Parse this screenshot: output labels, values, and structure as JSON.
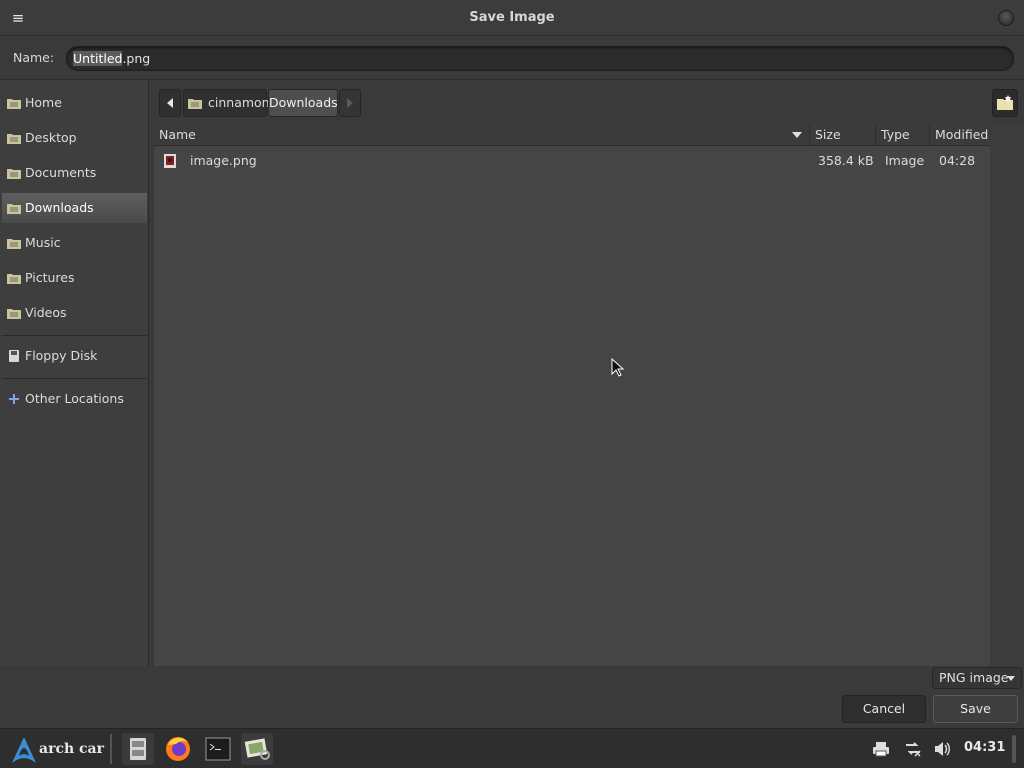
{
  "window": {
    "title": "Save Image",
    "menu_icon": "hamburger-menu-icon",
    "control_icon": "window-control-icon"
  },
  "name_row": {
    "label": "Name:",
    "value_selected": "Untitled",
    "value_rest": ".png"
  },
  "sidebar": {
    "places": [
      {
        "label": "Home",
        "icon": "folder-home-icon",
        "active": false
      },
      {
        "label": "Desktop",
        "icon": "folder-desktop-icon",
        "active": false
      },
      {
        "label": "Documents",
        "icon": "folder-documents-icon",
        "active": false
      },
      {
        "label": "Downloads",
        "icon": "folder-downloads-icon",
        "active": true
      },
      {
        "label": "Music",
        "icon": "folder-music-icon",
        "active": false
      },
      {
        "label": "Pictures",
        "icon": "folder-pictures-icon",
        "active": false
      },
      {
        "label": "Videos",
        "icon": "folder-videos-icon",
        "active": false
      }
    ],
    "devices": [
      {
        "label": "Floppy Disk",
        "icon": "floppy-disk-icon"
      }
    ],
    "other": {
      "label": "Other Locations",
      "icon": "plus-icon"
    }
  },
  "pathbar": {
    "back_icon": "chevron-left-icon",
    "crumbs": [
      "cinnamon",
      "Downloads"
    ],
    "forward_icon": "chevron-right-icon",
    "new_folder_icon": "new-folder-icon"
  },
  "columns": {
    "name": "Name",
    "size": "Size",
    "type": "Type",
    "modified": "Modified"
  },
  "files": [
    {
      "name": "image.png",
      "size": "358.4 kB",
      "type": "Image",
      "modified": "04:28",
      "icon": "image-file-icon"
    }
  ],
  "filter": {
    "selected": "PNG image"
  },
  "buttons": {
    "cancel": "Cancel",
    "save": "Save"
  },
  "taskbar": {
    "menu_label": "arch car",
    "launchers": [
      "files-icon",
      "firefox-icon",
      "terminal-icon",
      "image-viewer-icon"
    ],
    "tray": [
      "printer-icon",
      "network-icon",
      "volume-icon"
    ],
    "clock": "04:31"
  },
  "colors": {
    "window_bg": "#3a3a3a",
    "list_bg": "#454545",
    "taskbar_bg": "#2e2e2e",
    "selection_bg": "#4e4e4e"
  }
}
